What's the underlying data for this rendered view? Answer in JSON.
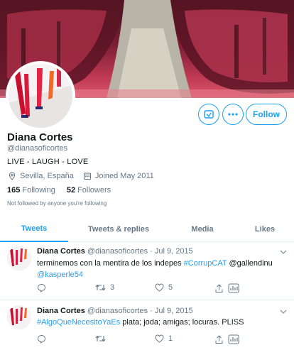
{
  "profile": {
    "name": "Diana Cortes",
    "handle": "@dianasoficortes",
    "bio": "LIVE - LAUGH - LOVE",
    "location": "Sevilla, España",
    "joined": "Joined May 2011",
    "following_count": "165",
    "following_label": "Following",
    "followers_count": "52",
    "followers_label": "Followers",
    "not_followed_text": "Not followed by anyone you're following"
  },
  "actions": {
    "follow_label": "Follow"
  },
  "tabs": [
    {
      "label": "Tweets",
      "active": true
    },
    {
      "label": "Tweets & replies",
      "active": false
    },
    {
      "label": "Media",
      "active": false
    },
    {
      "label": "Likes",
      "active": false
    }
  ],
  "tweets": [
    {
      "name": "Diana Cortes",
      "meta": "@dianasoficortes · Jul 9, 2015",
      "text_before": "terminemos con la mentira de los indepes ",
      "hashtag": "#CorrupCAT",
      "text_mid": " @gallendinu ",
      "mention": "@kasperle54",
      "retweets": "3",
      "likes": "5"
    },
    {
      "name": "Diana Cortes",
      "meta": "@dianasoficortes · Jul 9, 2015",
      "hashtag": "#AlgoQueNecesitoYaEs",
      "text_after": " plata; joda; amigas; locuras. PLISS",
      "likes": "1"
    }
  ],
  "colors": {
    "accent": "#1da1f2",
    "text": "#14171a",
    "secondary": "#657786"
  }
}
